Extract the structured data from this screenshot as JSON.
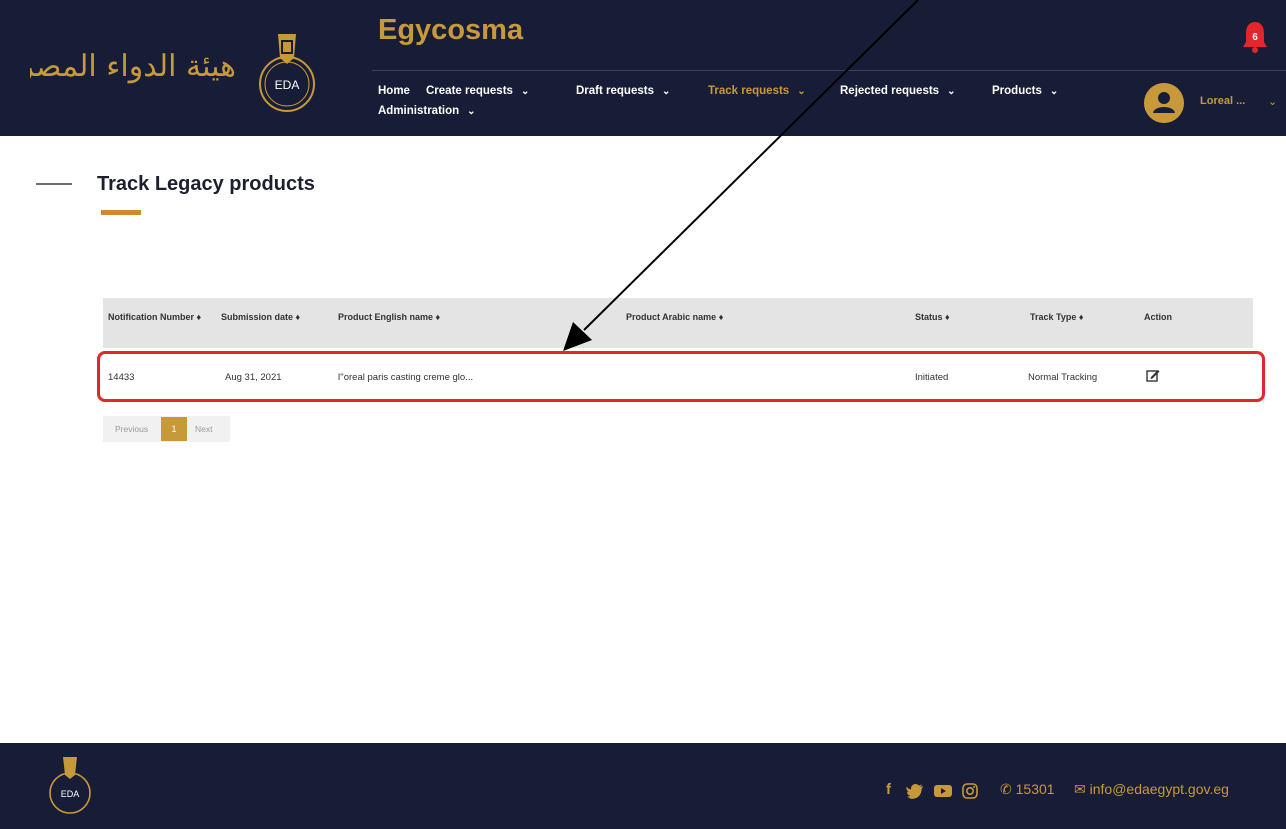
{
  "header": {
    "logo_arabic": "هيئة الدواء المصرية",
    "emblem_text": "EDA",
    "brand": "Egycosma",
    "notification_count": "6",
    "user_name": "Loreal ...",
    "nav_row1": [
      {
        "label": "Home",
        "has_dropdown": false,
        "active": false
      },
      {
        "label": "Create requests",
        "has_dropdown": true,
        "active": false
      },
      {
        "label": "Draft requests",
        "has_dropdown": true,
        "active": false
      },
      {
        "label": "Track requests",
        "has_dropdown": true,
        "active": true
      },
      {
        "label": "Rejected requests",
        "has_dropdown": true,
        "active": false
      },
      {
        "label": "Products",
        "has_dropdown": true,
        "active": false
      }
    ],
    "nav_row2": [
      {
        "label": "Administration",
        "has_dropdown": true,
        "active": false
      }
    ],
    "chevron": "⌄"
  },
  "page": {
    "title": "Track Legacy products"
  },
  "table": {
    "columns": [
      "Notification Number ♦",
      "Submission date ♦",
      "Product English name ♦",
      "Product Arabic name ♦",
      "Status ♦",
      "Track Type ♦",
      "Action"
    ],
    "rows": [
      {
        "notification_number": "14433",
        "submission_date": "Aug 31, 2021",
        "product_english_name": "l''oreal paris casting creme glo...",
        "product_arabic_name": "",
        "status": "Initiated",
        "track_type": "Normal Tracking"
      }
    ]
  },
  "pagination": {
    "previous": "Previous",
    "current": "1",
    "next": "Next"
  },
  "footer": {
    "emblem_text": "EDA",
    "social": [
      "facebook-icon",
      "twitter-icon",
      "youtube-icon",
      "instagram-icon"
    ],
    "phone": "15301",
    "email": "info@edaegypt.gov.eg"
  },
  "colors": {
    "navy": "#171d36",
    "gold": "#c8993a",
    "orange": "#d08a2e",
    "highlight_red": "#e3262b"
  }
}
